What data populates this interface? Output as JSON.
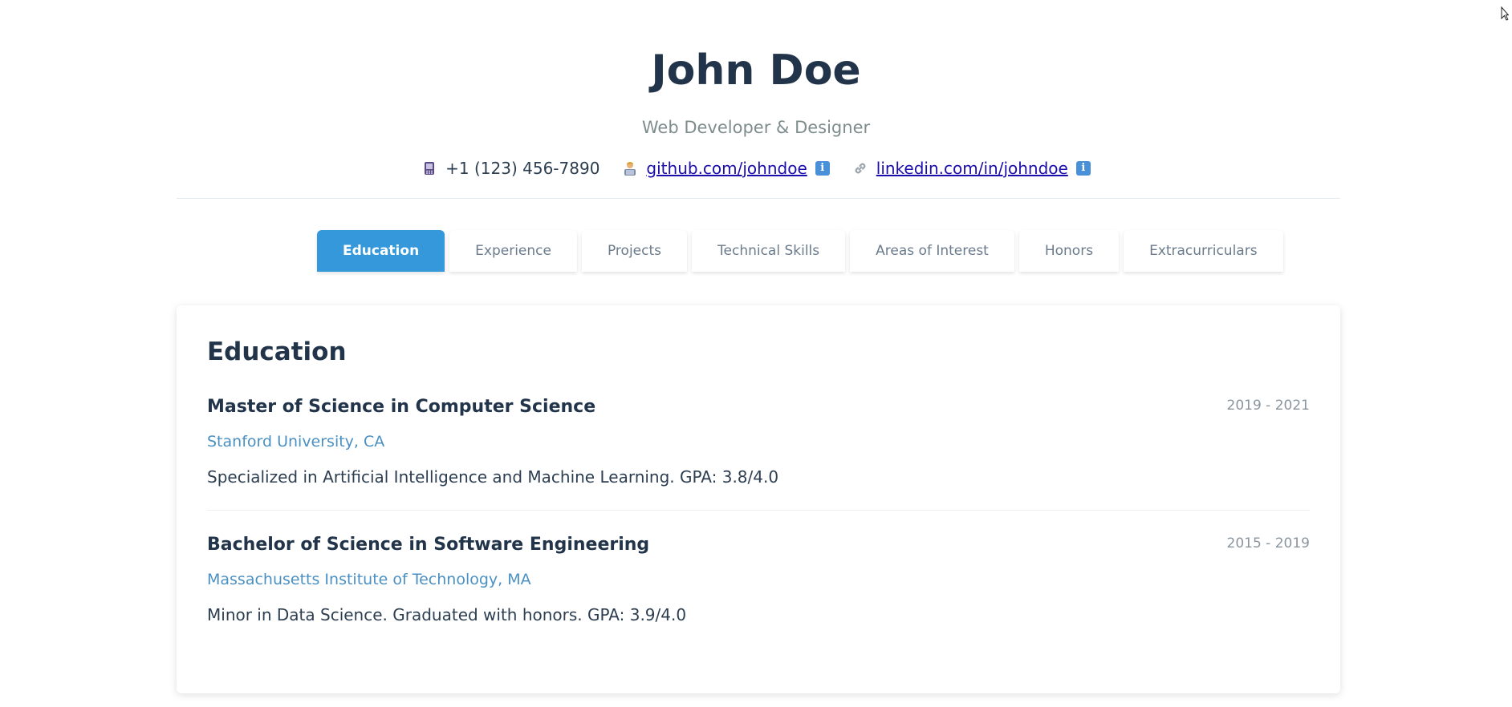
{
  "profile": {
    "name": "John Doe",
    "title": "Web Developer & Designer"
  },
  "contacts": {
    "phone": {
      "icon": "phone-icon",
      "text": "+1 (123) 456-7890"
    },
    "github": {
      "icon": "developer-icon",
      "text": "github.com/johndoe",
      "info_icon": "info-icon"
    },
    "linkedin": {
      "icon": "link-icon",
      "text": "linkedin.com/in/johndoe",
      "info_icon": "info-icon"
    }
  },
  "tabs": [
    {
      "label": "Education",
      "active": true
    },
    {
      "label": "Experience",
      "active": false
    },
    {
      "label": "Projects",
      "active": false
    },
    {
      "label": "Technical Skills",
      "active": false
    },
    {
      "label": "Areas of Interest",
      "active": false
    },
    {
      "label": "Honors",
      "active": false
    },
    {
      "label": "Extracurriculars",
      "active": false
    }
  ],
  "section": {
    "title": "Education",
    "entries": [
      {
        "degree": "Master of Science in Computer Science",
        "dates": "2019 - 2021",
        "school": "Stanford University, CA",
        "description": "Specialized in Artificial Intelligence and Machine Learning. GPA: 3.8/4.0"
      },
      {
        "degree": "Bachelor of Science in Software Engineering",
        "dates": "2015 - 2019",
        "school": "Massachusetts Institute of Technology, MA",
        "description": "Minor in Data Science. Graduated with honors. GPA: 3.9/4.0"
      }
    ]
  },
  "colors": {
    "accent": "#3498db",
    "heading": "#22344a",
    "muted": "#7f8c8d",
    "school_link": "#4a90c2",
    "contact_link": "#1a0dab"
  }
}
